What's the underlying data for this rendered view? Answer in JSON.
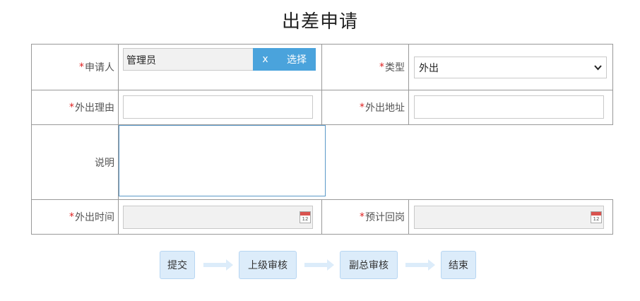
{
  "page": {
    "title": "出差申请"
  },
  "form": {
    "applicant": {
      "label": "申请人",
      "value": "管理员",
      "clear_label": "x",
      "select_label": "选择"
    },
    "type": {
      "label": "类型",
      "value": "外出"
    },
    "reason": {
      "label": "外出理由",
      "value": ""
    },
    "address": {
      "label": "外出地址",
      "value": ""
    },
    "description": {
      "label": "说明",
      "value": ""
    },
    "out_time": {
      "label": "外出时间",
      "value": ""
    },
    "return_time": {
      "label": "预计回岗",
      "value": ""
    },
    "required_mark": "*",
    "calendar_day": "12"
  },
  "workflow": {
    "steps": [
      {
        "label": "提交"
      },
      {
        "label": "上级审核"
      },
      {
        "label": "副总审核"
      },
      {
        "label": "结束"
      }
    ]
  },
  "icons": {
    "calendar": "calendar-icon",
    "chevron": "chevron-down-icon",
    "arrow": "arrow-right-icon"
  },
  "colors": {
    "primary": "#4aa3dc",
    "required": "#e02020",
    "step_bg": "#dcecfa"
  }
}
